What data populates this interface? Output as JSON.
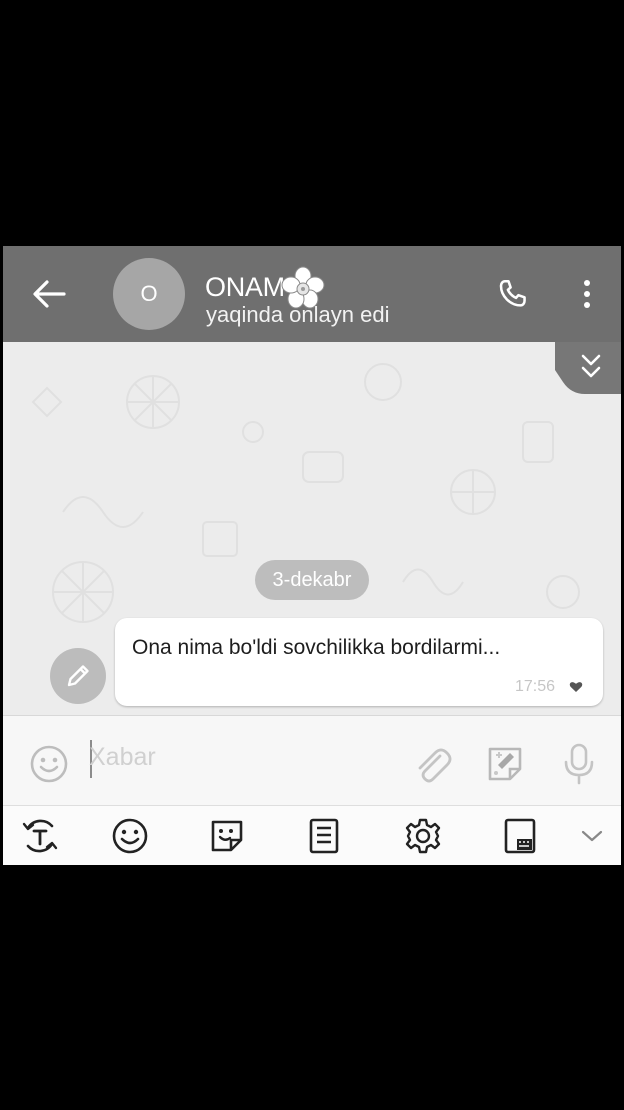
{
  "header": {
    "title": "ONAM",
    "title_emoji": "flower-icon",
    "status": "yaqinda onlayn edi",
    "avatar_letter": "O",
    "icons": [
      "back-arrow-icon",
      "phone-icon",
      "more-vert-icon"
    ]
  },
  "chat": {
    "date_label": "3-dekabr",
    "messages": [
      {
        "text": "Ona nima bo'ldi sovchilikka bordilarmi...",
        "time": "17:56",
        "status_icon": "heart-icon"
      }
    ]
  },
  "input": {
    "placeholder": "Xabar",
    "value": "",
    "icons": [
      "emoji-icon",
      "attach-icon",
      "sticker-icon",
      "microphone-icon"
    ]
  },
  "keyboard_toolbar": {
    "icons": [
      "translate-icon",
      "emoji-icon",
      "sticker-icon",
      "clipboard-icon",
      "settings-icon",
      "keyboard-icon",
      "chevron-down-icon"
    ]
  },
  "colors": {
    "header_bg": "#6f6f6f",
    "chat_bg": "#ececec",
    "bubble_bg": "#ffffff",
    "date_badge_bg": "#bdbdbd"
  }
}
